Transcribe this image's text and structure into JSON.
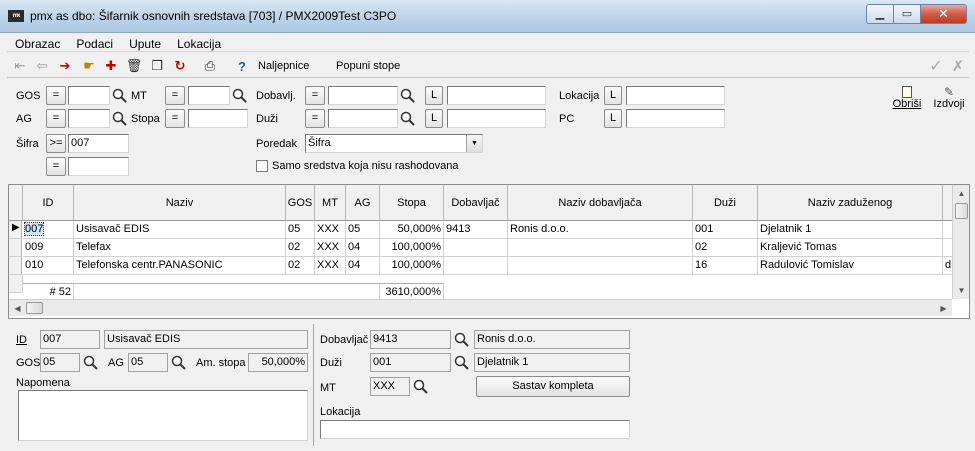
{
  "window": {
    "title": "pmx as dbo: Šifarnik osnovnih  sredstava [703] / PMX2009Test C3PO",
    "icon_text": "mx"
  },
  "menu": [
    "Obrazac",
    "Podaci",
    "Upute",
    "Lokacija"
  ],
  "toolbar": {
    "labels_button": "Naljepnice",
    "fill_rates_button": "Popuni stope"
  },
  "filters": {
    "gos_label": "GOS",
    "mt_label": "MT",
    "dobavljac_label": "Dobavlj.",
    "lokacija_label": "Lokacija",
    "ag_label": "AG",
    "stopa_label": "Stopa",
    "duzi_label": "Duži",
    "pc_label": "PC",
    "sifra_label": "Šifra",
    "sifra_op": ">=",
    "sifra_value": "007",
    "eq": "=",
    "l": "L",
    "poredak_label": "Poredak",
    "poredak_value": "Šifra",
    "only_active_label": "Samo sredstva koja nisu rashodovana",
    "obrisi": "Obriši",
    "izdvoji": "Izdvoji"
  },
  "grid": {
    "columns": [
      "ID",
      "Naziv",
      "GOS",
      "MT",
      "AG",
      "Stopa",
      "Dobavljač",
      "Naziv dobavljača",
      "Duži",
      "Naziv zaduženog"
    ],
    "rows": [
      [
        "007",
        "Usisavač EDIS",
        "05",
        "XXX",
        "05",
        "50,000%",
        "9413",
        "Ronis d.o.o.",
        "001",
        "Djelatnik 1",
        ""
      ],
      [
        "009",
        "Telefax",
        "02",
        "XXX",
        "04",
        "100,000%",
        "",
        "",
        "02",
        "Kraljević Tomas",
        ""
      ],
      [
        "010",
        "Telefonska centr.PANASONIC",
        "02",
        "XXX",
        "04",
        "100,000%",
        "",
        "",
        "16",
        "Radulović Tomislav",
        "d:"
      ]
    ],
    "footer": {
      "count": "# 52",
      "stopa_sum": "3610,000%"
    }
  },
  "detail": {
    "id_label": "ID",
    "id_value": "007",
    "name_value": "Usisavač EDIS",
    "gos_label": "GOS",
    "gos_value": "05",
    "ag_label": "AG",
    "ag_value": "05",
    "am_stopa_label": "Am. stopa",
    "am_stopa_value": "50,000%",
    "napomena_label": "Napomena",
    "dobavljac_label": "Dobavljač",
    "dobavljac_value": "9413",
    "dobavljac_name": "Ronis d.o.o.",
    "duzi_label": "Duži",
    "duzi_value": "001",
    "duzi_name": "Djelatnik 1",
    "mt_label": "MT",
    "mt_value": "XXX",
    "sastav_button": "Sastav kompleta",
    "lokacija_label": "Lokacija"
  }
}
